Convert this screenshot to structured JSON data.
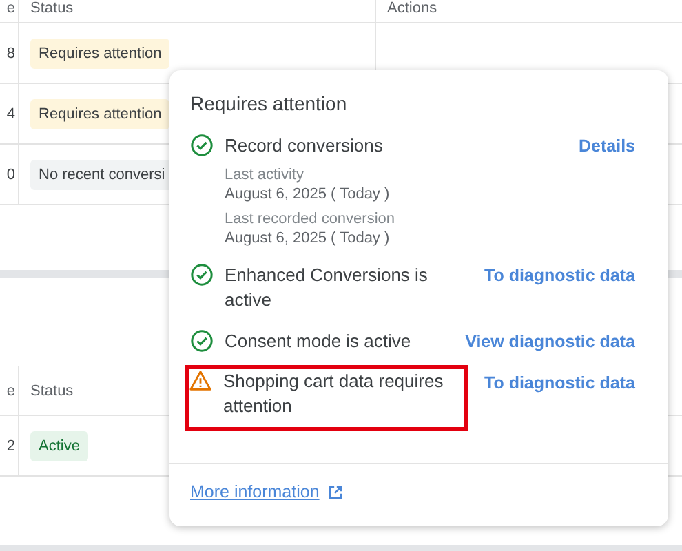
{
  "upper_table": {
    "columns": [
      "e",
      "Status",
      "Actions"
    ],
    "rows": [
      {
        "column_1": "8",
        "status": {
          "text": "Requires attention",
          "kind": "warning"
        }
      },
      {
        "column_1": "4",
        "status": {
          "text": "Requires attention",
          "kind": "warning"
        }
      },
      {
        "column_1": "0",
        "status": {
          "text": "No recent conversi",
          "kind": "neutral"
        }
      }
    ]
  },
  "lower_table": {
    "columns": [
      "e",
      "Status"
    ],
    "rows": [
      {
        "column_1": "2",
        "status": {
          "text": "Active",
          "kind": "active"
        }
      }
    ]
  },
  "popup": {
    "title": "Requires attention",
    "items": [
      {
        "kind": "ok",
        "label": "Record conversions",
        "link": "Details",
        "highlighted": false,
        "details": [
          {
            "label": "Last activity",
            "value": "August 6, 2025 ( Today )"
          },
          {
            "label": "Last recorded conversion",
            "value": "August 6, 2025 ( Today )"
          }
        ]
      },
      {
        "kind": "ok",
        "label": "Enhanced Conversions is active",
        "link": "To diagnostic data",
        "highlighted": false
      },
      {
        "kind": "ok",
        "label": "Consent mode is active",
        "link": "View diagnostic data",
        "highlighted": false
      },
      {
        "kind": "warning",
        "label": "Shopping cart data requires attention",
        "link": "To diagnostic data",
        "highlighted": true
      }
    ],
    "footer_link": "More information"
  }
}
